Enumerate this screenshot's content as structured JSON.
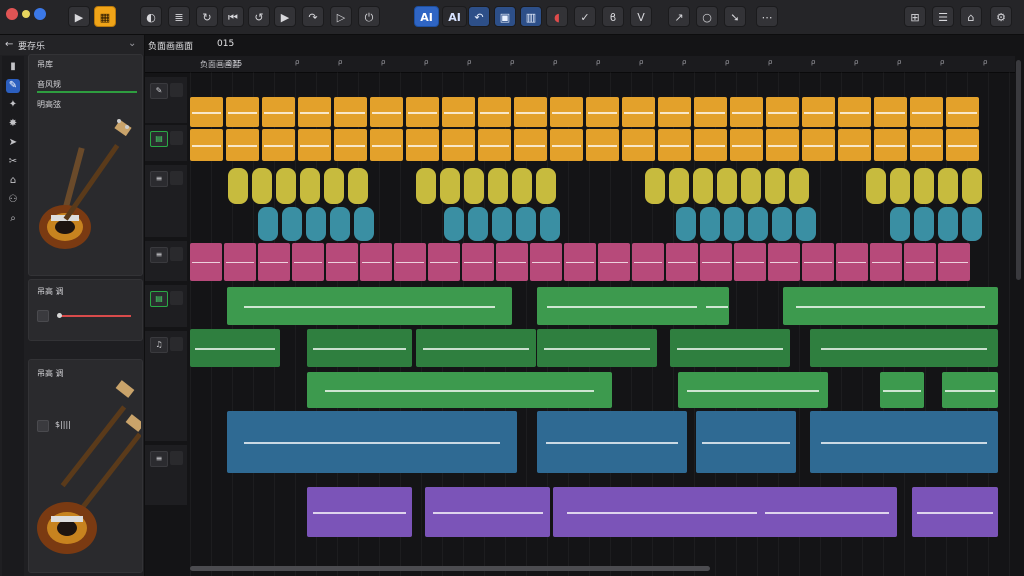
{
  "toolbar": {
    "traffic_colors": [
      "#e05454",
      "#e8d55e",
      "#3b78e7"
    ],
    "buttons": [
      {
        "name": "play-icon",
        "glyph": "▶",
        "state": "normal"
      },
      {
        "name": "library-icon",
        "glyph": "▦",
        "state": "active"
      },
      {
        "name": "smart-controls-icon",
        "glyph": "◐",
        "state": "normal"
      },
      {
        "name": "mixer-icon",
        "glyph": "≣",
        "state": "normal"
      },
      {
        "name": "loop-icon",
        "glyph": "↻",
        "state": "normal"
      },
      {
        "name": "skip-start-icon",
        "glyph": "⏮",
        "state": "normal"
      },
      {
        "name": "cycle-icon",
        "glyph": "↺",
        "state": "normal"
      },
      {
        "name": "play-button-icon",
        "glyph": "▶",
        "state": "normal"
      },
      {
        "name": "redo-icon",
        "glyph": "↷",
        "state": "normal"
      },
      {
        "name": "forward-icon",
        "glyph": "▷",
        "state": "normal"
      },
      {
        "name": "power-icon",
        "glyph": "⏻",
        "state": "normal"
      }
    ],
    "ai_labels": [
      "AI",
      "AI"
    ],
    "right_buttons": [
      {
        "name": "undo-icon",
        "glyph": "↶"
      },
      {
        "name": "edit-icon",
        "glyph": "▣"
      },
      {
        "name": "browser-icon",
        "glyph": "▥"
      },
      {
        "name": "record-icon",
        "glyph": "◖"
      },
      {
        "name": "check-icon",
        "glyph": "✓"
      },
      {
        "name": "bracket-icon",
        "glyph": "ϐ"
      },
      {
        "name": "shield-icon",
        "glyph": "Ⅴ"
      },
      {
        "name": "share-icon",
        "glyph": "↗"
      },
      {
        "name": "record-dot-icon",
        "glyph": "○"
      },
      {
        "name": "arrow-icon",
        "glyph": "➘"
      },
      {
        "name": "more-icon",
        "glyph": "⋯"
      },
      {
        "name": "window-icon",
        "glyph": "⊞"
      },
      {
        "name": "list-icon",
        "glyph": "☰"
      },
      {
        "name": "store-icon",
        "glyph": "⌂"
      },
      {
        "name": "settings-icon",
        "glyph": "⚙"
      }
    ]
  },
  "left_panel": {
    "back_glyph": "←",
    "title": "要存乐",
    "collapse_glyph": "⌄",
    "tool_glyphs": [
      "▮",
      "✎",
      "✦",
      "✸",
      "➤",
      "✂",
      "⌂",
      "⚇",
      "⌕"
    ],
    "card1": {
      "label1": "吊库",
      "label2": "音风规",
      "label3": "明高弦"
    },
    "card2": {
      "label1": "吊高 调"
    },
    "card3": {
      "label1": "吊高 调",
      "label2": "$||||"
    }
  },
  "arrange": {
    "title": "负面画画面",
    "title_suffix": "015",
    "ruler_text": "负面画画面",
    "ruler_number": "015",
    "ruler_marks": [
      "ρ",
      "ρ",
      "ρ",
      "ρ",
      "ρ",
      "ρ",
      "ρ",
      "ρ",
      "ρ",
      "ρ",
      "ρ",
      "ρ",
      "ρ",
      "ρ",
      "ρ",
      "ρ",
      "ρ",
      "ρ",
      "ρ",
      "ρ"
    ],
    "track_header_icons": [
      "wrench-icon",
      "drum-icon",
      "midi-icon",
      "keys-icon",
      "guitar-icon",
      "bass-icon",
      "synth-icon"
    ],
    "colors": {
      "orange": "#e3a12b",
      "orange_dark": "#c98920",
      "yellow": "#c7bb3e",
      "teal": "#3a8fa3",
      "pink": "#b74a7a",
      "green": "#3d9a4e",
      "green_dark": "#2f7f3f",
      "blue": "#2f6a93",
      "purple": "#7b54b8"
    }
  }
}
